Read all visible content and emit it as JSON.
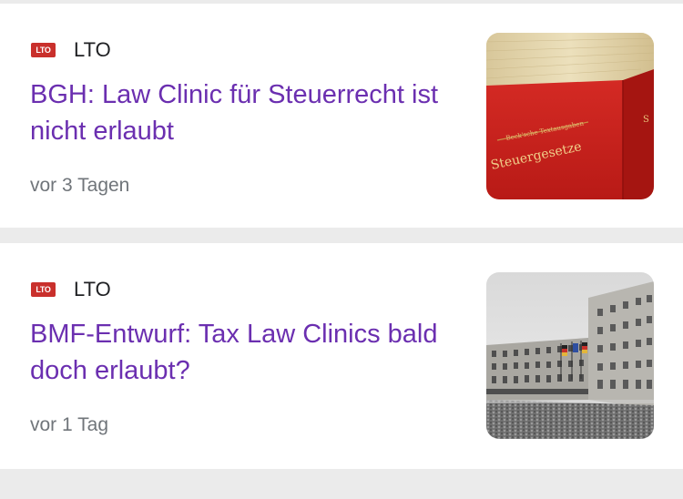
{
  "articles": [
    {
      "source": "LTO",
      "logo_text": "LTO",
      "logo_color": "#c9302c",
      "headline": "BGH: Law Clinic für Steuerrecht ist nicht erlaubt",
      "time": "vor 3 Tagen",
      "thumbnail_icon": "red-law-book-thumbnail",
      "thumbnail_text": "Steuergesetze"
    },
    {
      "source": "LTO",
      "logo_text": "LTO",
      "logo_color": "#c9302c",
      "headline": "BMF-Entwurf: Tax Law Clinics bald doch erlaubt?",
      "time": "vor 1 Tag",
      "thumbnail_icon": "ministry-building-thumbnail"
    }
  ],
  "colors": {
    "headline": "#6b2fb0",
    "meta": "#70757a",
    "background": "#ebebeb"
  }
}
